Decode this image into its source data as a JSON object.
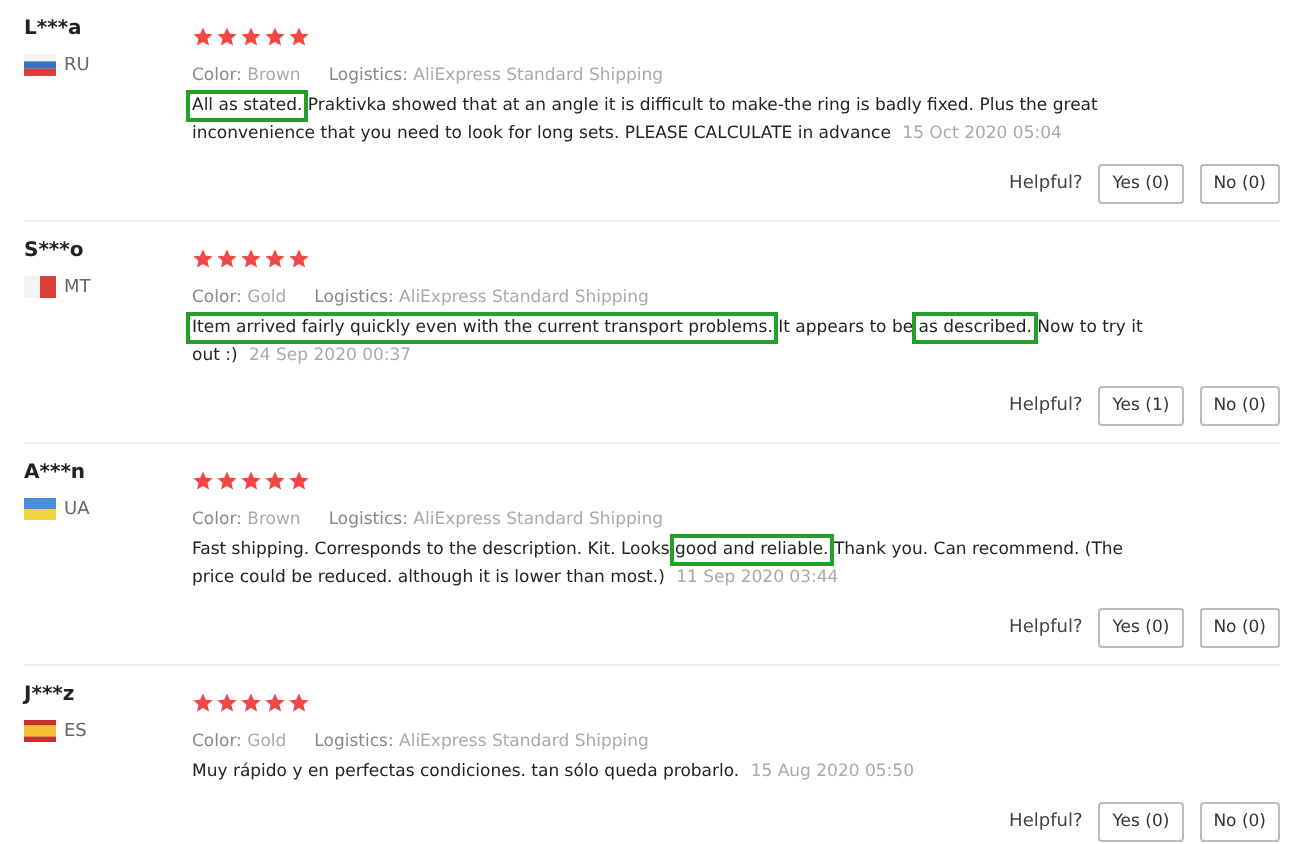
{
  "reviews": [
    {
      "user": "L***a",
      "country": "RU",
      "stars": 5,
      "color_label": "Color:",
      "color_value": "Brown",
      "logistics_label": "Logistics:",
      "logistics_value": "AliExpress Standard Shipping",
      "text": [
        {
          "text": "All as stated.",
          "highlighted": true
        },
        {
          "text": " Praktivka showed that at an angle it is difficult to make-the ring is badly fixed. Plus the great inconvenience that you need to look for long sets. PLEASE CALCULATE in advance",
          "highlighted": false
        }
      ],
      "date": "15 Oct 2020 05:04",
      "helpful": "Helpful?",
      "yes": "Yes (0)",
      "no": "No (0)"
    },
    {
      "user": "S***o",
      "country": "MT",
      "stars": 5,
      "color_label": "Color:",
      "color_value": "Gold",
      "logistics_label": "Logistics:",
      "logistics_value": "AliExpress Standard Shipping",
      "text": [
        {
          "text": "Item arrived fairly quickly even with the current transport problems.",
          "highlighted": true
        },
        {
          "text": " It appears to be ",
          "highlighted": false
        },
        {
          "text": "as described.",
          "highlighted": true
        },
        {
          "text": " Now to try it out :)",
          "highlighted": false
        }
      ],
      "date": "24 Sep 2020 00:37",
      "helpful": "Helpful?",
      "yes": "Yes (1)",
      "no": "No (0)"
    },
    {
      "user": "A***n",
      "country": "UA",
      "stars": 5,
      "color_label": "Color:",
      "color_value": "Brown",
      "logistics_label": "Logistics:",
      "logistics_value": "AliExpress Standard Shipping",
      "text": [
        {
          "text": "Fast shipping. Corresponds to the description. Kit. Looks ",
          "highlighted": false
        },
        {
          "text": "good and reliable.",
          "highlighted": true
        },
        {
          "text": " Thank you. Can recommend. (The price could be reduced. although it is lower than most.)",
          "highlighted": false
        }
      ],
      "date": "11 Sep 2020 03:44",
      "helpful": "Helpful?",
      "yes": "Yes (0)",
      "no": "No (0)"
    },
    {
      "user": "J***z",
      "country": "ES",
      "stars": 5,
      "color_label": "Color:",
      "color_value": "Gold",
      "logistics_label": "Logistics:",
      "logistics_value": "AliExpress Standard Shipping",
      "text": [
        {
          "text": "Muy rápido y en perfectas condiciones. tan sólo queda probarlo.",
          "highlighted": false
        }
      ],
      "date": "15 Aug 2020 05:50",
      "helpful": "Helpful?",
      "yes": "Yes (0)",
      "no": "No (0)"
    }
  ]
}
